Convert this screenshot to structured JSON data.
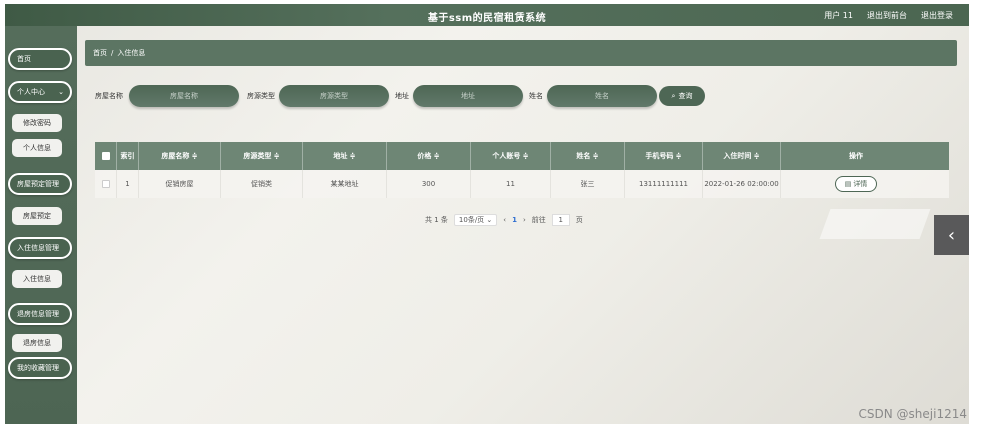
{
  "topbar": {
    "title": "基于ssm的民宿租赁系统",
    "user": "用户 11",
    "exit_front": "退出到前台",
    "logout": "退出登录"
  },
  "sidebar": {
    "items": [
      {
        "label": "首页"
      },
      {
        "label": "个人中心"
      },
      {
        "label": "修改密码"
      },
      {
        "label": "个人信息"
      },
      {
        "label": "房屋预定管理"
      },
      {
        "label": "房屋预定"
      },
      {
        "label": "入住信息管理"
      },
      {
        "label": "入住信息"
      },
      {
        "label": "退房信息管理"
      },
      {
        "label": "退房信息"
      },
      {
        "label": "我的收藏管理"
      }
    ]
  },
  "breadcrumb": {
    "home": "首页",
    "sep": "/",
    "current": "入住信息"
  },
  "search": {
    "house_name_label": "房屋名称",
    "house_name_placeholder": "房屋名称",
    "house_type_label": "房源类型",
    "house_type_placeholder": "房源类型",
    "address_label": "地址",
    "address_placeholder": "地址",
    "name_label": "姓名",
    "name_placeholder": "姓名",
    "query_button": "查询"
  },
  "table": {
    "headers": {
      "index": "索引",
      "house_name": "房屋名称 ≑",
      "house_type": "房源类型 ≑",
      "address": "地址 ≑",
      "price": "价格 ≑",
      "account": "个人账号 ≑",
      "name": "姓名 ≑",
      "phone": "手机号码 ≑",
      "checkin_time": "入住时间 ≑",
      "actions": "操作"
    },
    "rows": [
      {
        "index": "1",
        "house_name": "促销房屋",
        "house_type": "促销类",
        "address": "某某地址",
        "price": "300",
        "account": "11",
        "name": "张三",
        "phone": "13111111111",
        "checkin_time": "2022-01-26 02:00:00",
        "action": "详情"
      }
    ]
  },
  "pager": {
    "total": "共 1 条",
    "page_size": "10条/页",
    "current": "1",
    "goto_label": "前往",
    "goto_value": "1",
    "page_suffix": "页"
  },
  "watermark": "CSDN @sheji1214",
  "colors": {
    "primary": "#4e6755",
    "header": "#6e8675",
    "accent_link": "#2f6fd1"
  }
}
